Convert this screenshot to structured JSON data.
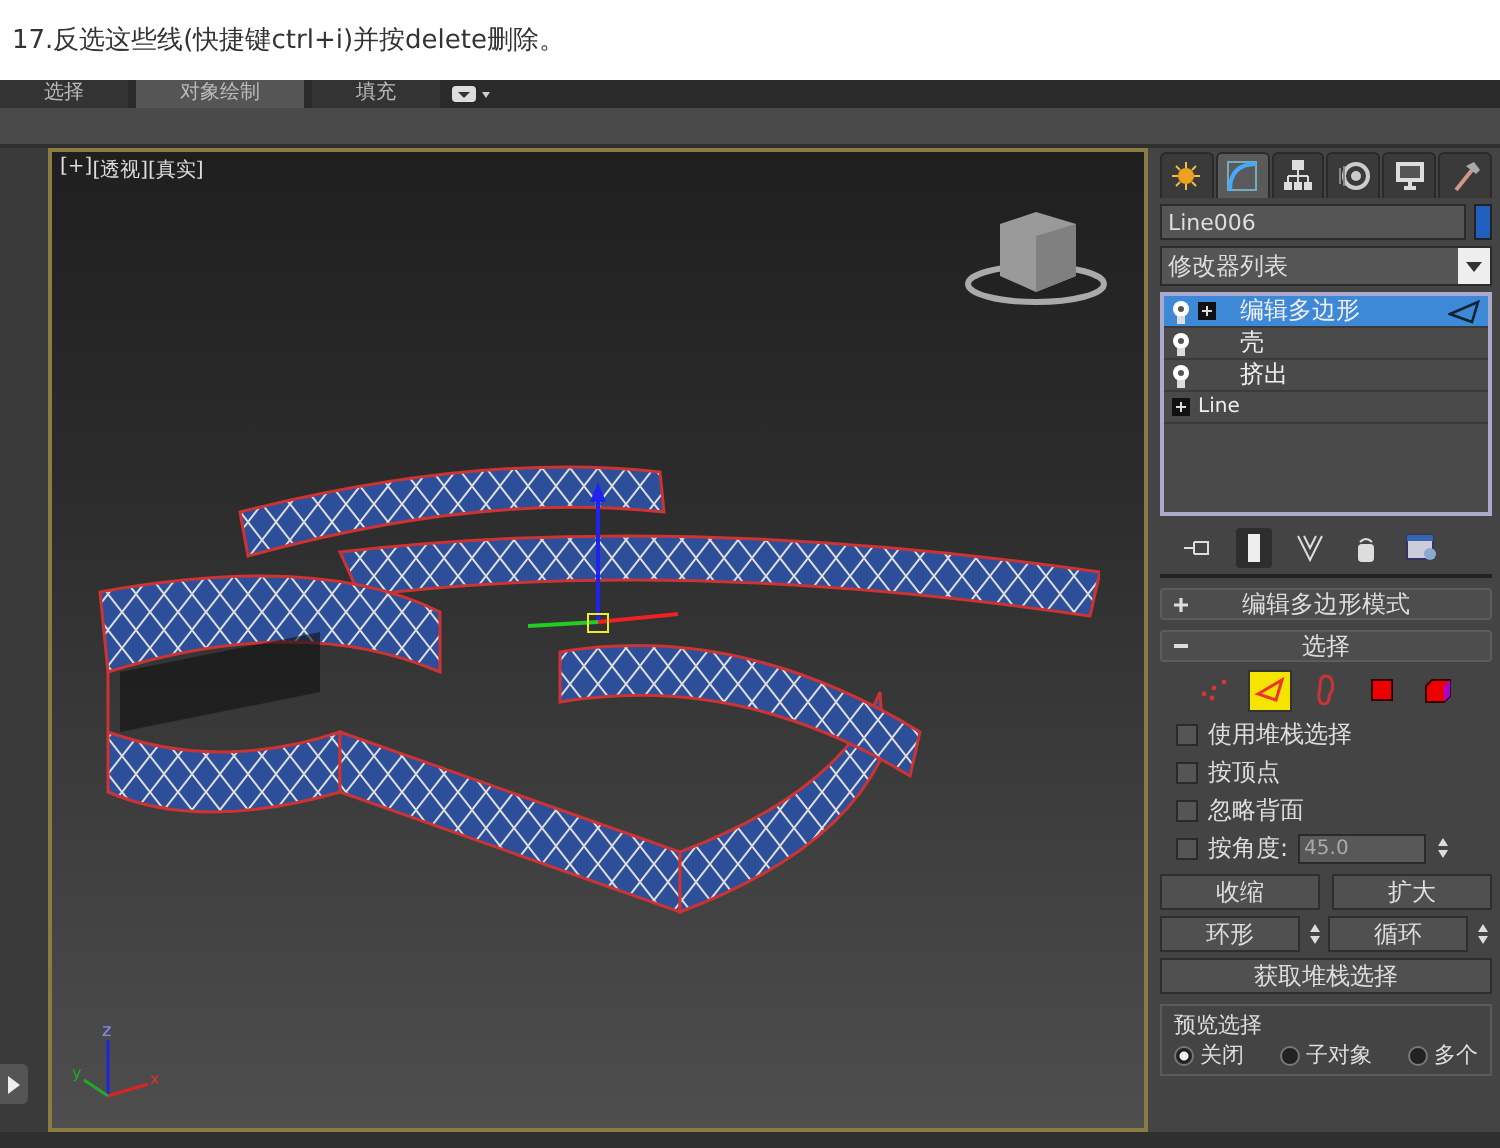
{
  "caption": "17.反选这些线(快捷键ctrl+i)并按delete删除。",
  "ribbon_tabs": [
    {
      "label": "选择",
      "selected": false
    },
    {
      "label": "对象绘制",
      "selected": true
    },
    {
      "label": "填充",
      "selected": false
    }
  ],
  "viewport": {
    "labels": [
      "[+]",
      "[透视]",
      "[真实]"
    ],
    "axis_labels": [
      "z",
      "y",
      "x"
    ]
  },
  "command_tabs": [
    {
      "kind": "create",
      "selected": false
    },
    {
      "kind": "modify",
      "selected": true
    },
    {
      "kind": "hierarchy",
      "selected": false
    },
    {
      "kind": "motion",
      "selected": false
    },
    {
      "kind": "display",
      "selected": false
    },
    {
      "kind": "utilities",
      "selected": false
    }
  ],
  "object_name": "Line006",
  "modifier_dropdown": "修改器列表",
  "modifier_stack": [
    {
      "label": "编辑多边形",
      "kind": "modifier",
      "expandable": true,
      "selected": true
    },
    {
      "label": "壳",
      "kind": "modifier",
      "expandable": false,
      "selected": false
    },
    {
      "label": "挤出",
      "kind": "modifier",
      "expandable": false,
      "selected": false
    },
    {
      "label": "Line",
      "kind": "base",
      "expandable": true,
      "selected": false
    }
  ],
  "rollouts": [
    {
      "title": "编辑多边形模式",
      "expanded": false
    },
    {
      "title": "选择",
      "expanded": true
    }
  ],
  "subobject_levels": [
    {
      "kind": "vertex",
      "selected": false
    },
    {
      "kind": "edge",
      "selected": true
    },
    {
      "kind": "border",
      "selected": false
    },
    {
      "kind": "polygon",
      "selected": false
    },
    {
      "kind": "element",
      "selected": false
    }
  ],
  "options": [
    {
      "label": "使用堆栈选择",
      "checked": false
    },
    {
      "label": "按顶点",
      "checked": false
    },
    {
      "label": "忽略背面",
      "checked": false
    },
    {
      "label": "按角度:",
      "checked": false,
      "value": "45.0"
    }
  ],
  "grow_buttons": [
    "收缩",
    "扩大"
  ],
  "loop_buttons": [
    "环形",
    "循环"
  ],
  "stack_button": "获取堆栈选择",
  "preview": {
    "title": "预览选择",
    "options": [
      {
        "label": "关闭",
        "selected": true
      },
      {
        "label": "子对象",
        "selected": false
      },
      {
        "label": "多个",
        "selected": false
      }
    ]
  }
}
